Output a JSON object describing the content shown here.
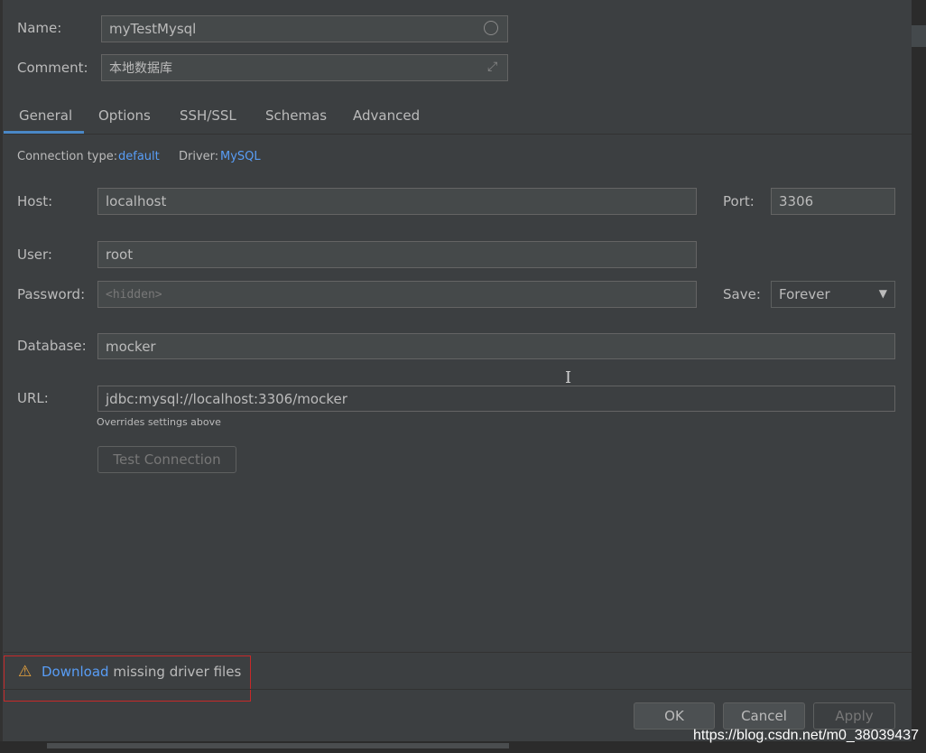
{
  "header": {
    "name_label": "Name:",
    "name_value": "myTestMysql",
    "comment_label": "Comment:",
    "comment_value": "本地数据库"
  },
  "tabs": [
    {
      "label": "General",
      "active": true
    },
    {
      "label": "Options"
    },
    {
      "label": "SSH/SSL"
    },
    {
      "label": "Schemas"
    },
    {
      "label": "Advanced"
    }
  ],
  "general": {
    "connection_type_label": "Connection type:",
    "connection_type_value": "default",
    "driver_label": "Driver:",
    "driver_value": "MySQL",
    "host_label": "Host:",
    "host_value": "localhost",
    "port_label": "Port:",
    "port_value": "3306",
    "user_label": "User:",
    "user_value": "root",
    "password_label": "Password:",
    "password_placeholder": "<hidden>",
    "save_label": "Save:",
    "save_value": "Forever",
    "database_label": "Database:",
    "database_value": "mocker",
    "url_label": "URL:",
    "url_value": "jdbc:mysql://localhost:3306/mocker",
    "url_hint": "Overrides settings above",
    "test_connection_label": "Test Connection"
  },
  "warning": {
    "link_text": "Download",
    "rest_text": " missing driver files"
  },
  "footer": {
    "ok_label": "OK",
    "cancel_label": "Cancel",
    "apply_label": "Apply"
  },
  "watermark": "https://blog.csdn.net/m0_38039437",
  "colors": {
    "background": "#3c3f41",
    "link": "#589df6",
    "tab_underline": "#4a88c7",
    "warning_border": "#c72929",
    "warning_icon": "#e8a33d"
  }
}
